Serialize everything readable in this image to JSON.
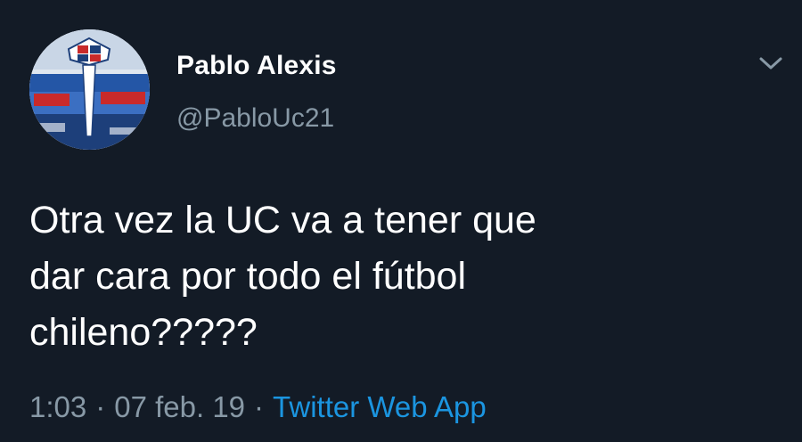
{
  "tweet": {
    "display_name": "Pablo Alexis",
    "handle": "@PabloUc21",
    "text": "Otra vez la UC va a tener que\ndar cara por todo el fútbol\nchileno?????",
    "time": "1:03",
    "date": "07 feb. 19",
    "separator": "·",
    "source": "Twitter Web App"
  },
  "icons": {
    "menu": "chevron-down-icon",
    "avatar": "avatar-image"
  },
  "colors": {
    "background": "#131b26",
    "primary_text": "#ffffff",
    "secondary_text": "#8899a6",
    "link": "#1b95e0"
  }
}
